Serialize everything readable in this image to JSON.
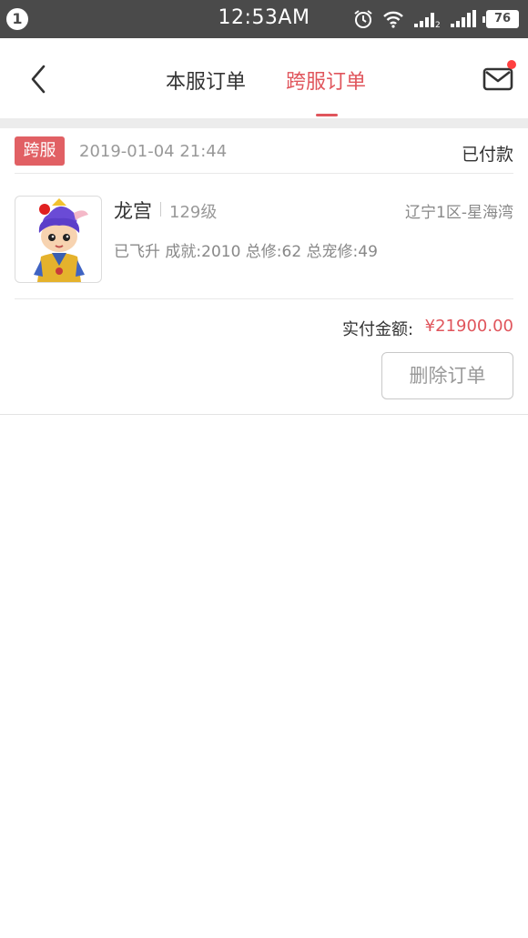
{
  "status_bar": {
    "notification_count": "1",
    "time": "12:53AM",
    "battery": "76"
  },
  "nav": {
    "tabs": [
      {
        "label": "本服订单"
      },
      {
        "label": "跨服订单"
      }
    ],
    "active_tab": 1
  },
  "order": {
    "tag": "跨服",
    "datetime": "2019-01-04 21:44",
    "status": "已付款",
    "role": {
      "name": "龙宫",
      "level": "129级",
      "server": "辽宁1区-星海湾",
      "stats": "已飞升 成就:2010 总修:62 总宠修:49"
    },
    "pay_label": "实付金额:",
    "pay_amount": "¥21900.00",
    "delete_button": "删除订单"
  },
  "colors": {
    "accent": "#e0555c",
    "status_bar": "#4a4a4a",
    "separator": "#ececec"
  }
}
